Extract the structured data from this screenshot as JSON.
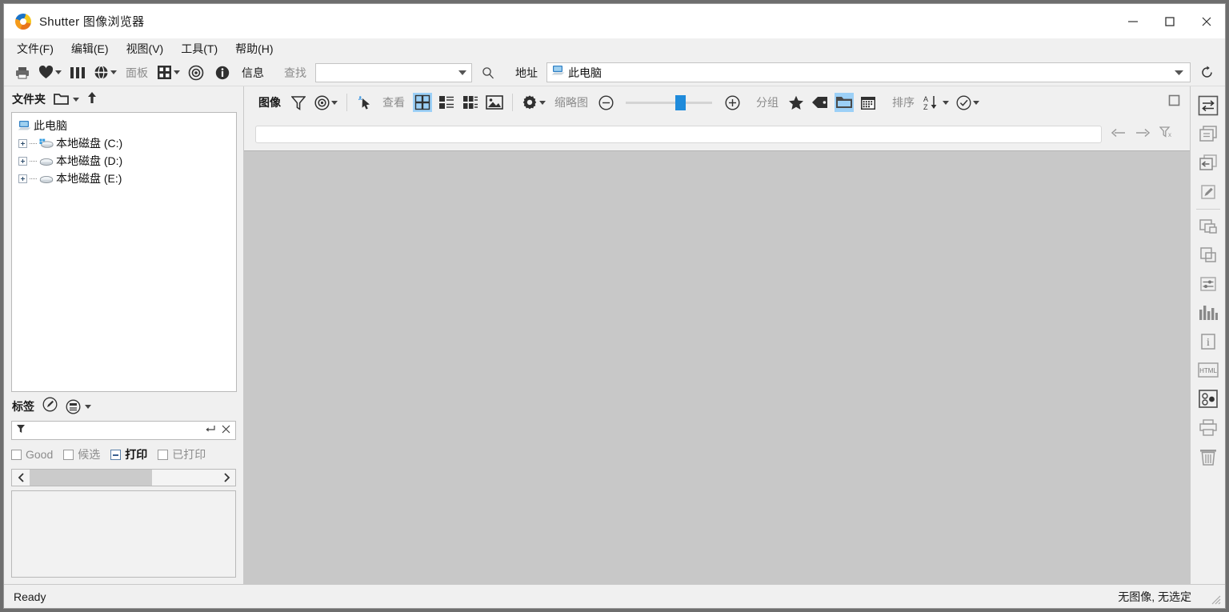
{
  "window": {
    "title": "Shutter 图像浏览器",
    "logo_icon": "shutter-logo-icon",
    "minimize_label": "—",
    "maximize_label": "□",
    "close_label": "✕"
  },
  "menubar": {
    "items": [
      {
        "label": "文件(F)",
        "name": "menu-file"
      },
      {
        "label": "编辑(E)",
        "name": "menu-edit"
      },
      {
        "label": "视图(V)",
        "name": "menu-view"
      },
      {
        "label": "工具(T)",
        "name": "menu-tools"
      },
      {
        "label": "帮助(H)",
        "name": "menu-help"
      }
    ]
  },
  "toolbar": {
    "print_icon": "printer-icon",
    "favorite_icon": "heart-icon",
    "columns_icon": "columns-icon",
    "globe_icon": "globe-icon",
    "panel_label": "面板",
    "grid_icon": "grid-icon",
    "eye_icon": "eye-icon",
    "info_icon": "info-circle-icon",
    "info_label": "信息",
    "find_label": "查找",
    "find_value": "",
    "find_placeholder": "",
    "search_icon": "search-icon",
    "address_label": "地址",
    "address_value": "此电脑",
    "address_icon": "computer-icon",
    "address_dropdown_icon": "chevron-down-icon",
    "refresh_icon": "refresh-icon"
  },
  "folders_panel": {
    "title": "文件夹",
    "open_folder_icon": "open-folder-icon",
    "up_icon": "arrow-up-icon",
    "tree": [
      {
        "label": "此电脑",
        "icon": "computer-icon",
        "level": 0,
        "expandable": false
      },
      {
        "label": "本地磁盘 (C:)",
        "icon": "drive-windows-icon",
        "level": 1,
        "expandable": true
      },
      {
        "label": "本地磁盘 (D:)",
        "icon": "drive-icon",
        "level": 1,
        "expandable": true
      },
      {
        "label": "本地磁盘 (E:)",
        "icon": "drive-icon",
        "level": 1,
        "expandable": true
      }
    ]
  },
  "tags_panel": {
    "title": "标签",
    "edit_icon": "pencil-circle-icon",
    "list_icon": "tag-list-icon",
    "filter_icon": "filter-icon",
    "filter_value": "",
    "enter_icon": "enter-icon",
    "clear_icon": "close-icon",
    "tags": [
      {
        "label": "Good",
        "state": "unchecked"
      },
      {
        "label": "候选",
        "state": "unchecked"
      },
      {
        "label": "打印",
        "state": "partial"
      },
      {
        "label": "已打印",
        "state": "unchecked"
      }
    ],
    "scroll_left_icon": "chevron-left-icon",
    "scroll_right_icon": "chevron-right-icon"
  },
  "image_toolbar": {
    "title": "图像",
    "filter_icon": "funnel-icon",
    "view_target_icon": "target-icon",
    "select_icon": "select-cursor-icon",
    "view_label": "查看",
    "view_modes": [
      {
        "name": "view-mode-thumbnails",
        "icon": "thumbnail-grid-icon",
        "active": true
      },
      {
        "name": "view-mode-list",
        "icon": "list-detail-icon",
        "active": false
      },
      {
        "name": "view-mode-filmstrip",
        "icon": "filmstrip-icon",
        "active": false
      },
      {
        "name": "view-mode-single",
        "icon": "single-image-icon",
        "active": false
      }
    ],
    "settings_icon": "gear-icon",
    "thumbnail_label": "缩略图",
    "zoom_out_icon": "minus-circle-icon",
    "zoom_in_icon": "plus-circle-icon",
    "zoom_value": 57,
    "group_label": "分组",
    "group_modes": [
      {
        "name": "group-rating",
        "icon": "star-icon",
        "active": false
      },
      {
        "name": "group-tag",
        "icon": "tag-icon",
        "active": false
      },
      {
        "name": "group-folder",
        "icon": "folder-icon",
        "active": true
      },
      {
        "name": "group-date",
        "icon": "calendar-icon",
        "active": false
      }
    ],
    "sort_label": "排序",
    "sort_icon": "sort-az-icon",
    "check_icon": "check-circle-icon",
    "maximize_panel_icon": "maximize-panel-icon"
  },
  "filter_bar": {
    "value": "",
    "placeholder": "",
    "back_icon": "arrow-left-icon",
    "forward_icon": "arrow-right-icon",
    "clear_filter_icon": "clear-filter-icon"
  },
  "right_rail": {
    "items": [
      {
        "name": "swap-icon",
        "active": true
      },
      {
        "name": "copy-icon",
        "active": false
      },
      {
        "name": "move-icon",
        "active": false
      },
      {
        "name": "edit-pencil-icon",
        "active": false
      },
      {
        "name": "divider",
        "active": false
      },
      {
        "name": "stack-icon",
        "active": false
      },
      {
        "name": "overlap-icon",
        "active": false
      },
      {
        "name": "adjust-sliders-icon",
        "active": false
      },
      {
        "name": "histogram-icon",
        "active": false
      },
      {
        "name": "info-icon",
        "active": false
      },
      {
        "name": "html-icon",
        "active": false
      },
      {
        "name": "dot-select-icon",
        "active": true
      },
      {
        "name": "print-icon",
        "active": false
      },
      {
        "name": "trash-icon",
        "active": false
      }
    ]
  },
  "statusbar": {
    "left": "Ready",
    "right": "无图像, 无选定"
  },
  "colors": {
    "accent": "#1f8bdb",
    "highlight": "#9cd0f7",
    "chrome": "#f0f0f0",
    "content": "#c8c8c8"
  }
}
